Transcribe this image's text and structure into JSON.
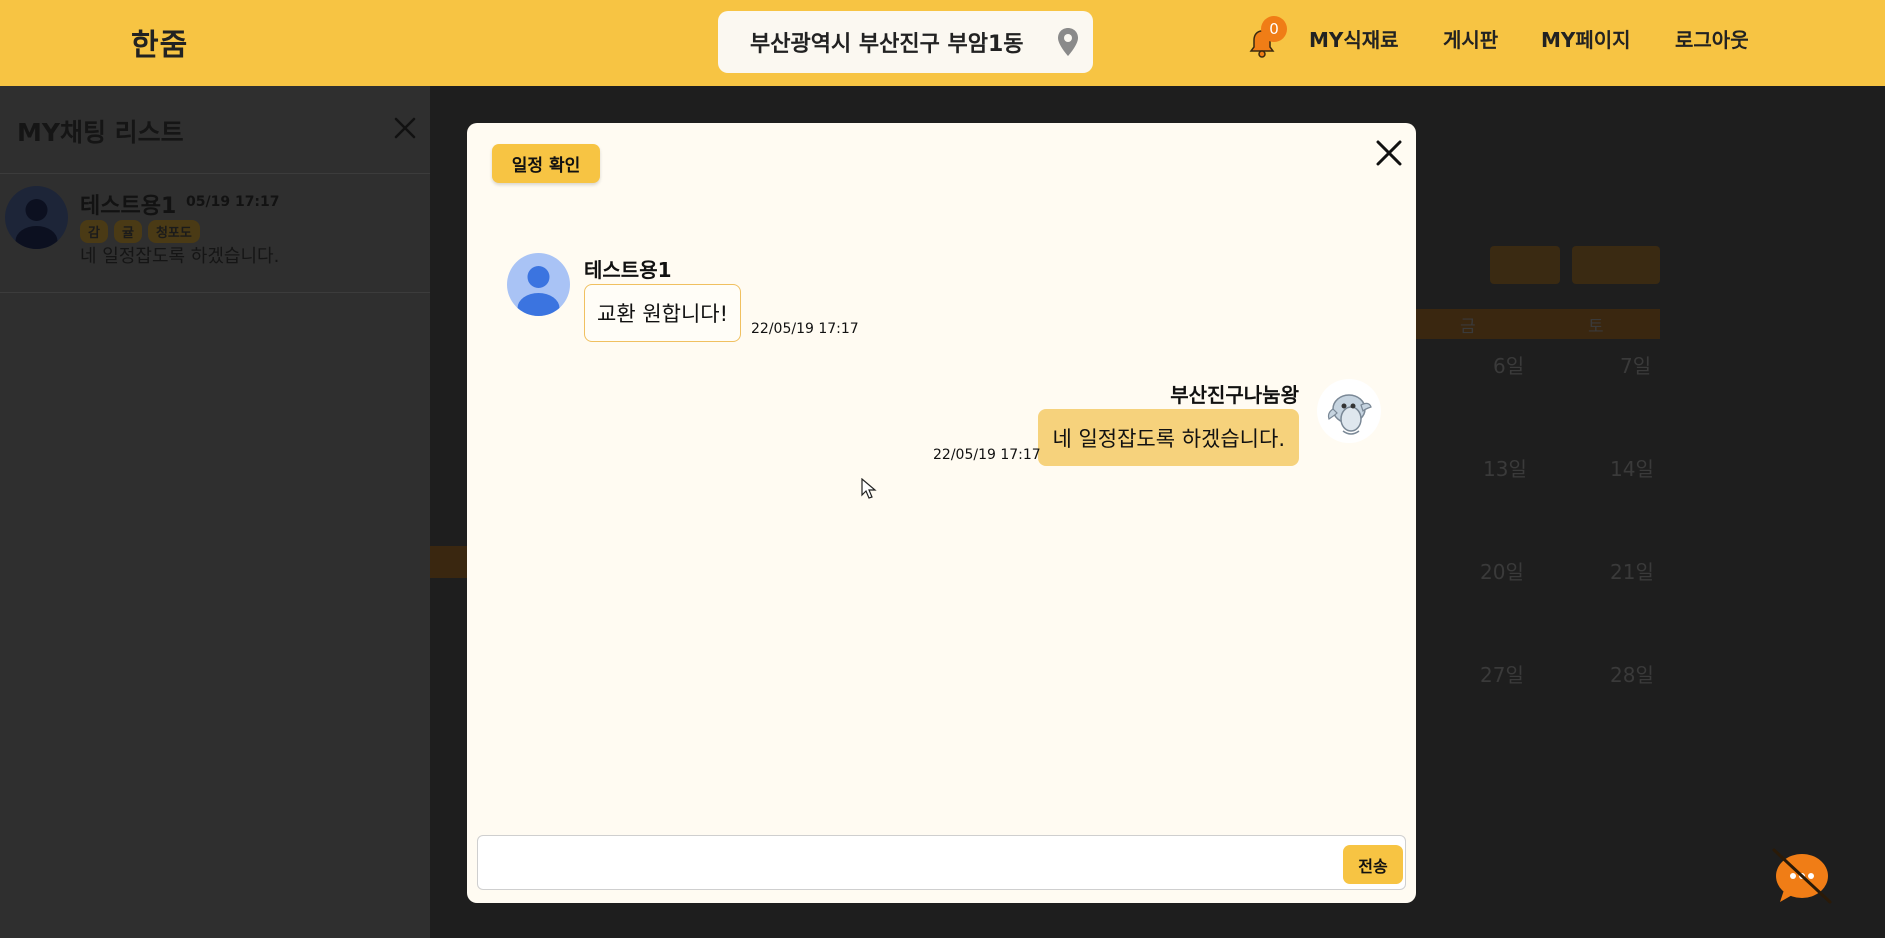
{
  "header": {
    "logo": "한줌",
    "location": "부산광역시 부산진구 부암1동",
    "notification_count": "0",
    "nav": [
      "MY식재료",
      "게시판",
      "MY페이지",
      "로그아웃"
    ]
  },
  "side_panel": {
    "title": "MY채팅 리스트",
    "chats": [
      {
        "name": "테스트용1",
        "time": "05/19 17:17",
        "tags": [
          "감",
          "귤",
          "청포도"
        ],
        "preview": "네 일정잡도록 하겠습니다."
      }
    ]
  },
  "background_calendar": {
    "days": [
      "금",
      "토"
    ],
    "dates": [
      "6일",
      "7일",
      "13일",
      "14일",
      "20일",
      "21일",
      "27일",
      "28일"
    ]
  },
  "modal": {
    "schedule_button": "일정 확인",
    "messages": [
      {
        "name": "테스트용1",
        "text": "교환 원합니다!",
        "time": "22/05/19 17:17",
        "direction": "incoming"
      },
      {
        "name": "부산진구나눔왕",
        "text": "네 일정잡도록 하겠습니다.",
        "time": "22/05/19 17:17",
        "direction": "outgoing"
      }
    ],
    "input_placeholder": "",
    "send_label": "전송"
  },
  "colors": {
    "brand": "#f7c443",
    "bubble_out": "#f6d27c",
    "badge": "#f07d16",
    "modal_bg": "#fffbf2"
  },
  "icons": [
    "map-pin-icon",
    "bell-icon",
    "close-icon",
    "user-avatar-icon",
    "dolphin-avatar-icon",
    "chat-fab-icon"
  ]
}
